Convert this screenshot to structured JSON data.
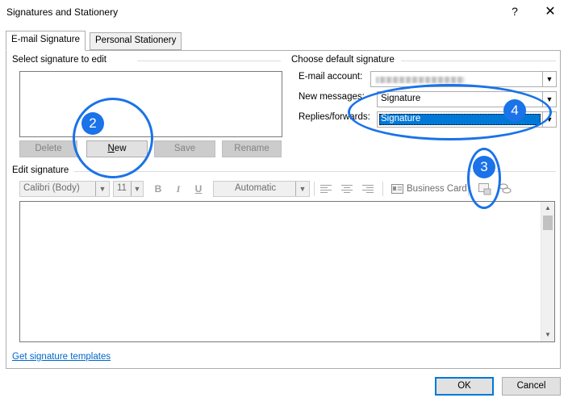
{
  "window": {
    "title": "Signatures and Stationery",
    "help": "?",
    "close": "✕"
  },
  "tabs": [
    {
      "label": "E-mail Signature",
      "active": true
    },
    {
      "label": "Personal Stationery",
      "active": false
    }
  ],
  "select_section": {
    "title": "Select signature to edit",
    "buttons": {
      "delete": "Delete",
      "new": "New",
      "save": "Save",
      "rename": "Rename"
    }
  },
  "default_section": {
    "title": "Choose default signature",
    "email_account_label": "E-mail account:",
    "new_messages_label": "New messages:",
    "new_messages_value": "Signature",
    "replies_label": "Replies/forwards:",
    "replies_value": "Signature"
  },
  "edit_section": {
    "title": "Edit signature",
    "font": "Calibri (Body)",
    "size": "11",
    "bold": "B",
    "italic": "I",
    "underline": "U",
    "color": "Automatic",
    "business_card": "Business Card"
  },
  "footer": {
    "templates_link": "Get signature templates",
    "ok": "OK",
    "cancel": "Cancel"
  },
  "callouts": {
    "two": "2",
    "three": "3",
    "four": "4"
  },
  "colors": {
    "callout": "#1a73e8",
    "link": "#0066cc",
    "selection": "#0078d7"
  }
}
